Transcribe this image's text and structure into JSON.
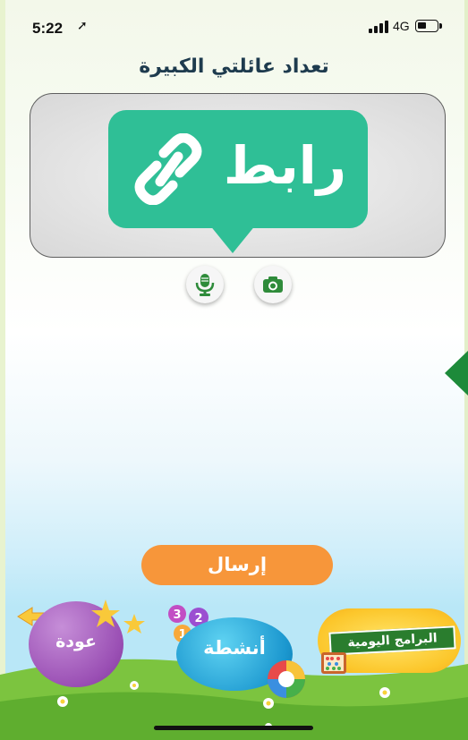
{
  "status_bar": {
    "time": "5:22",
    "location_icon": "location-arrow-icon",
    "network": "4G",
    "signal_icon": "signal-bars-icon",
    "battery_icon": "battery-icon",
    "battery_level": 0.45
  },
  "header": {
    "title": "تعداد عائلتي الكبيرة"
  },
  "image_card": {
    "logo_text": "رابط",
    "logo_icon": "chain-link-icon",
    "brand_color": "#2fbf96"
  },
  "media_buttons": {
    "mic_icon": "microphone-icon",
    "camera_icon": "camera-icon",
    "icon_color": "#2e8b3a"
  },
  "side_nav": {
    "icon": "arrow-left-icon",
    "color": "#1d8a3a"
  },
  "actions": {
    "send_label": "إرسال",
    "send_color": "#f7963a"
  },
  "bottom_nav": {
    "back_label": "عودة",
    "activities_label": "أنشطة",
    "daily_programs_label": "البرامج اليومية",
    "number_balls": [
      "3",
      "2",
      "1"
    ]
  }
}
